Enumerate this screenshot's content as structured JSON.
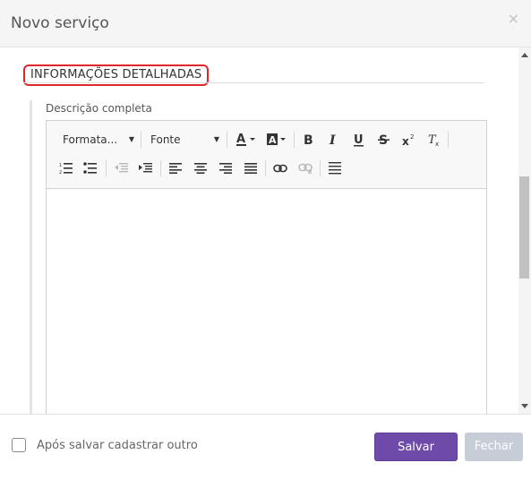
{
  "dialog": {
    "title": "Novo serviço",
    "close_symbol": "×"
  },
  "section": {
    "title": "INFORMAÇÕES DETALHADAS",
    "highlight_color": "#e0262b"
  },
  "field": {
    "label": "Descrição completa"
  },
  "editor": {
    "format_combo": "Formata...",
    "font_combo": "Fonte",
    "content": ""
  },
  "footer": {
    "checkbox_label": "Após salvar cadastrar outro",
    "save_label": "Salvar",
    "close_label": "Fechar",
    "save_color": "#6e4ba8",
    "close_color": "#c7cdd6"
  }
}
